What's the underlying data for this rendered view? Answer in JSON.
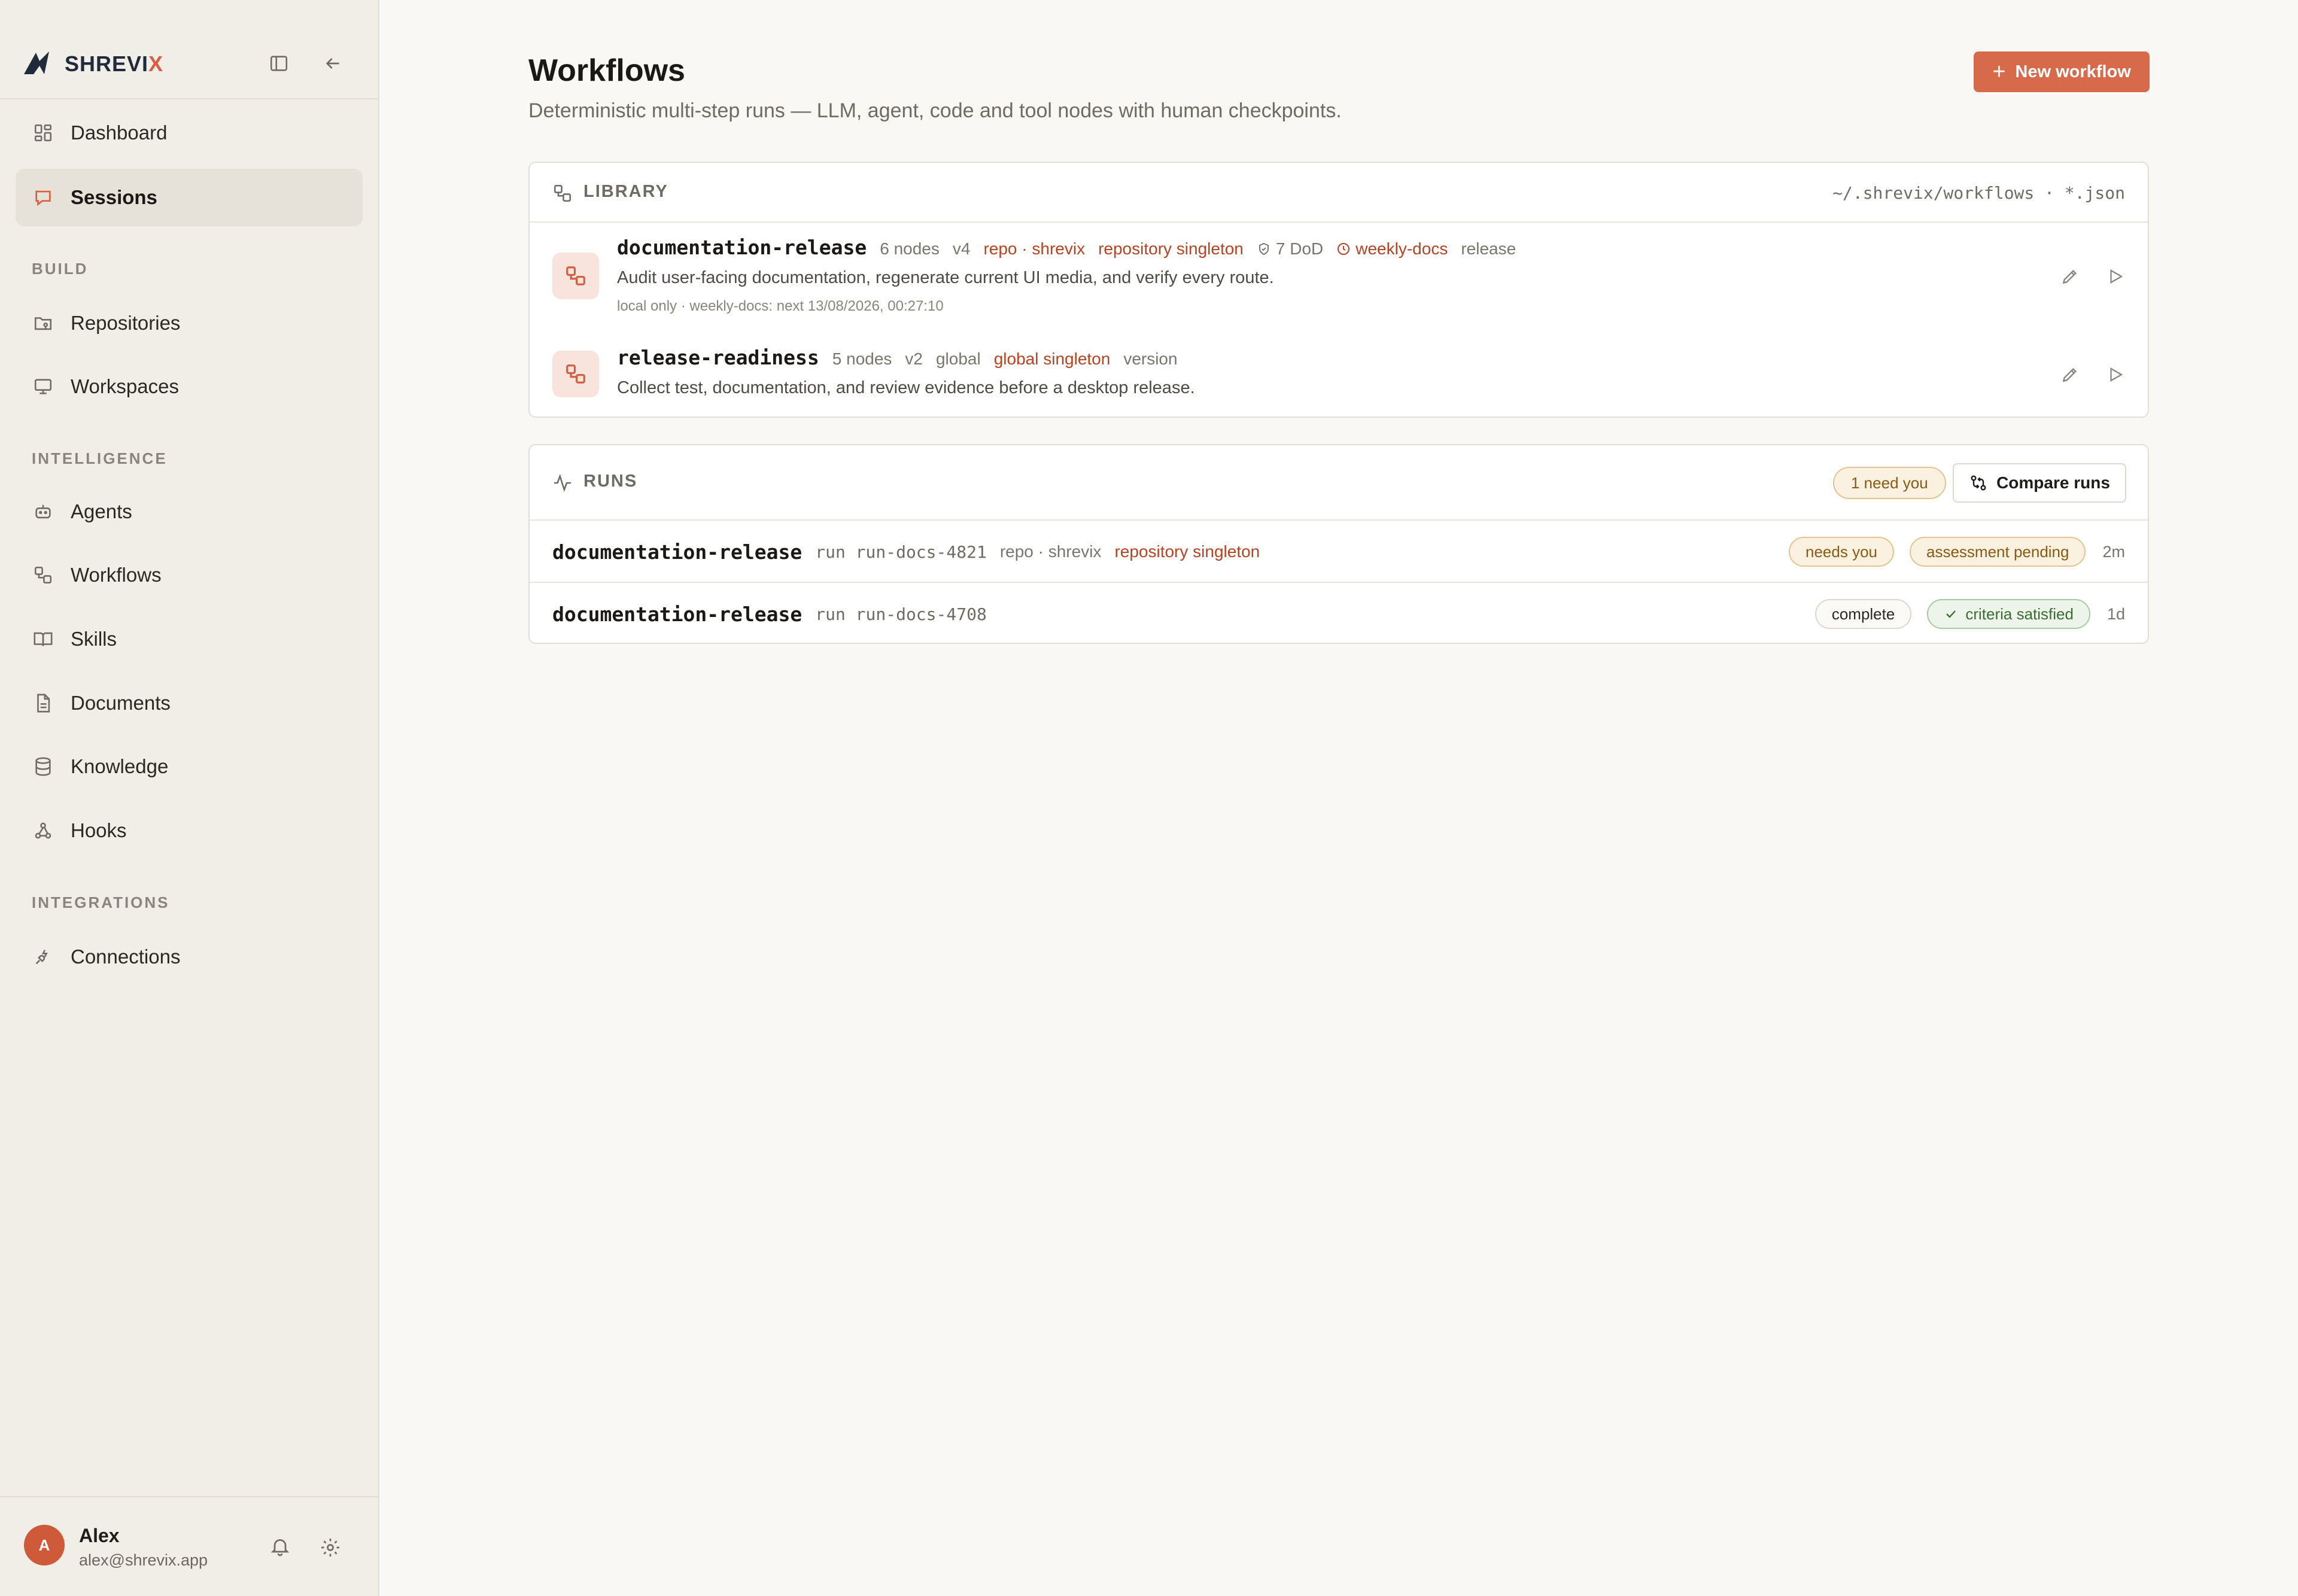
{
  "brand": {
    "name_main": "SHREVI",
    "name_accent": "X",
    "accent_color": "#d8603f"
  },
  "sidebar": {
    "top_items": [
      {
        "label": "Dashboard",
        "icon": "dashboard-icon"
      },
      {
        "label": "Sessions",
        "icon": "chat-icon",
        "active": true
      }
    ],
    "sections": [
      {
        "label": "BUILD",
        "items": [
          {
            "label": "Repositories",
            "icon": "folder-git-icon"
          },
          {
            "label": "Workspaces",
            "icon": "monitor-icon"
          }
        ]
      },
      {
        "label": "INTELLIGENCE",
        "items": [
          {
            "label": "Agents",
            "icon": "bot-icon"
          },
          {
            "label": "Workflows",
            "icon": "workflow-icon"
          },
          {
            "label": "Skills",
            "icon": "book-icon"
          },
          {
            "label": "Documents",
            "icon": "document-icon"
          },
          {
            "label": "Knowledge",
            "icon": "database-icon"
          },
          {
            "label": "Hooks",
            "icon": "webhook-icon"
          }
        ]
      },
      {
        "label": "INTEGRATIONS",
        "items": [
          {
            "label": "Connections",
            "icon": "plug-icon"
          }
        ]
      }
    ],
    "user": {
      "initial": "A",
      "name": "Alex",
      "email": "alex@shrevix.app"
    }
  },
  "page": {
    "title": "Workflows",
    "subtitle": "Deterministic multi-step runs — LLM, agent, code and tool nodes with human checkpoints.",
    "new_button": "New workflow"
  },
  "library": {
    "title": "LIBRARY",
    "path": "~/.shrevix/workflows · *.json",
    "workflows": [
      {
        "name": "documentation-release",
        "nodes": "6 nodes",
        "version": "v4",
        "scope": "repo · shrevix",
        "singleton": "repository singleton",
        "dod": "7 DoD",
        "schedule": "weekly-docs",
        "category": "release",
        "description": "Audit user-facing documentation, regenerate current UI media, and verify every route.",
        "meta": "local only · weekly-docs: next 13/08/2026, 00:27:10"
      },
      {
        "name": "release-readiness",
        "nodes": "5 nodes",
        "version": "v2",
        "scope": "global",
        "singleton": "global singleton",
        "category": "version",
        "description": "Collect test, documentation, and review evidence before a desktop release."
      }
    ]
  },
  "runs": {
    "title": "RUNS",
    "need_badge": "1 need you",
    "compare_button": "Compare runs",
    "items": [
      {
        "name": "documentation-release",
        "run_id": "run run-docs-4821",
        "scope": "repo · shrevix",
        "singleton": "repository singleton",
        "status": "needs you",
        "assessment": "assessment pending",
        "age": "2m"
      },
      {
        "name": "documentation-release",
        "run_id": "run run-docs-4708",
        "status": "complete",
        "assessment": "criteria satisfied",
        "age": "1d"
      }
    ]
  }
}
